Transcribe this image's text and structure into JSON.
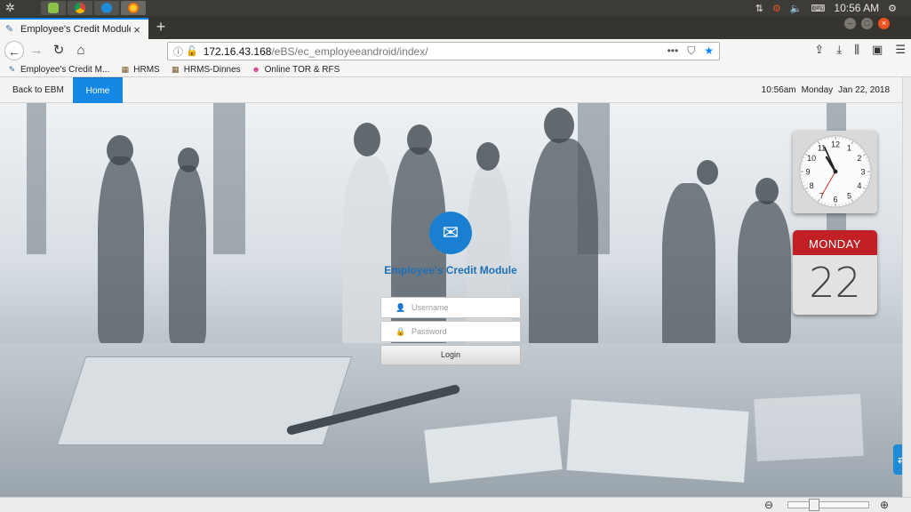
{
  "os": {
    "clock": "10:56 AM",
    "launcher_icon": "ubuntu-logo-icon",
    "tray_icons": [
      "network-icon",
      "updates-icon",
      "volume-icon",
      "keyboard-icon"
    ]
  },
  "browser": {
    "tab_title": "Employee's Credit Module",
    "tab_close": "×",
    "new_tab": "+",
    "url_host": "172.16.43.168",
    "url_path": "/eBS/ec_employeeandroid/index/",
    "url_more": "•••",
    "bookmarks": [
      {
        "label": "Employee's Credit M...",
        "icon": "page-icon"
      },
      {
        "label": "HRMS",
        "icon": "film-icon"
      },
      {
        "label": "HRMS-Dinnes",
        "icon": "film-icon"
      },
      {
        "label": "Online TOR & RFS",
        "icon": "smiley-icon"
      }
    ]
  },
  "app_nav": {
    "back_label": "Back to EBM",
    "home_label": "Home",
    "time": "10:56am",
    "weekday": "Monday",
    "date": "Jan 22, 2018"
  },
  "login": {
    "title": "Employee's Credit Module",
    "username_placeholder": "Username",
    "password_placeholder": "Password",
    "login_label": "Login"
  },
  "clock_widget": {
    "numbers": [
      "12",
      "1",
      "2",
      "3",
      "4",
      "5",
      "6",
      "7",
      "8",
      "9",
      "10",
      "11"
    ],
    "hour": 10,
    "minute": 56,
    "second": 35
  },
  "calendar_widget": {
    "day_name": "MONDAY",
    "day_number": "22"
  },
  "colors": {
    "accent": "#1588e5",
    "title_blue": "#1d6fb6",
    "calendar_red": "#c12026"
  }
}
